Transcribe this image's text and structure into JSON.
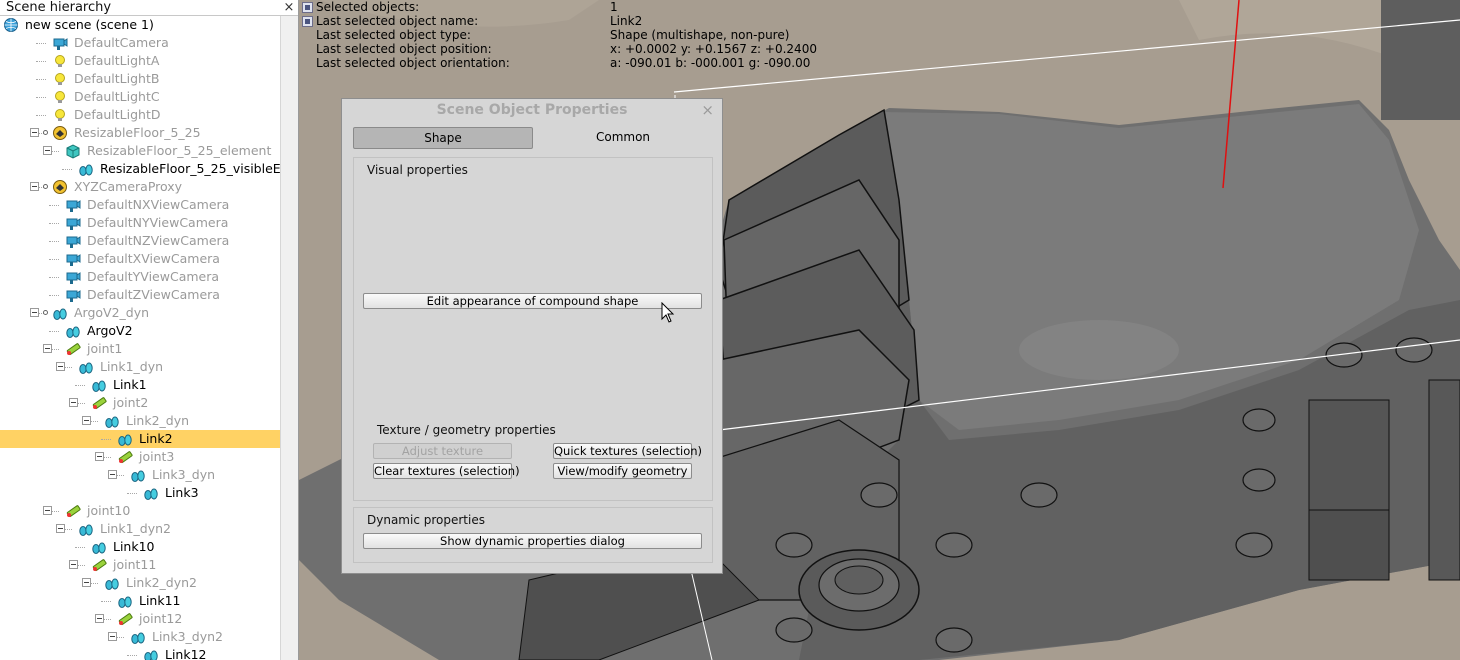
{
  "hierarchy": {
    "title": "Scene hierarchy",
    "close": "×",
    "items": [
      {
        "label": "new scene (scene 1)",
        "icon": "globe-icon",
        "depth": 0,
        "dim": false,
        "selected": false
      },
      {
        "label": "DefaultCamera",
        "icon": "camera-icon",
        "depth": 3,
        "dim": true,
        "selected": false
      },
      {
        "label": "DefaultLightA",
        "icon": "light-bulb-icon",
        "depth": 3,
        "dim": true,
        "selected": false
      },
      {
        "label": "DefaultLightB",
        "icon": "light-bulb-icon",
        "depth": 3,
        "dim": true,
        "selected": false
      },
      {
        "label": "DefaultLightC",
        "icon": "light-bulb-icon",
        "depth": 3,
        "dim": true,
        "selected": false
      },
      {
        "label": "DefaultLightD",
        "icon": "light-bulb-icon",
        "depth": 3,
        "dim": true,
        "selected": false
      },
      {
        "label": "ResizableFloor_5_25",
        "icon": "model-icon",
        "depth": 3,
        "dim": true,
        "selected": false
      },
      {
        "label": "ResizableFloor_5_25_element",
        "icon": "cube-icon",
        "depth": 4,
        "dim": true,
        "selected": false
      },
      {
        "label": "ResizableFloor_5_25_visibleElement",
        "icon": "shape-icon",
        "depth": 5,
        "dim": false,
        "selected": false
      },
      {
        "label": "XYZCameraProxy",
        "icon": "model-icon",
        "depth": 3,
        "dim": true,
        "selected": false
      },
      {
        "label": "DefaultNXViewCamera",
        "icon": "camera-icon",
        "depth": 4,
        "dim": true,
        "selected": false
      },
      {
        "label": "DefaultNYViewCamera",
        "icon": "camera-icon",
        "depth": 4,
        "dim": true,
        "selected": false
      },
      {
        "label": "DefaultNZViewCamera",
        "icon": "camera-icon",
        "depth": 4,
        "dim": true,
        "selected": false
      },
      {
        "label": "DefaultXViewCamera",
        "icon": "camera-icon",
        "depth": 4,
        "dim": true,
        "selected": false
      },
      {
        "label": "DefaultYViewCamera",
        "icon": "camera-icon",
        "depth": 4,
        "dim": true,
        "selected": false
      },
      {
        "label": "DefaultZViewCamera",
        "icon": "camera-icon",
        "depth": 4,
        "dim": true,
        "selected": false
      },
      {
        "label": "ArgoV2_dyn",
        "icon": "shape-icon",
        "depth": 3,
        "dim": true,
        "selected": false
      },
      {
        "label": "ArgoV2",
        "icon": "shape-icon",
        "depth": 4,
        "dim": false,
        "selected": false
      },
      {
        "label": "joint1",
        "icon": "joint-icon",
        "depth": 4,
        "dim": true,
        "selected": false
      },
      {
        "label": "Link1_dyn",
        "icon": "shape-icon",
        "depth": 5,
        "dim": true,
        "selected": false
      },
      {
        "label": "Link1",
        "icon": "shape-icon",
        "depth": 6,
        "dim": false,
        "selected": false
      },
      {
        "label": "joint2",
        "icon": "joint-icon",
        "depth": 6,
        "dim": true,
        "selected": false
      },
      {
        "label": "Link2_dyn",
        "icon": "shape-icon",
        "depth": 7,
        "dim": true,
        "selected": false
      },
      {
        "label": "Link2",
        "icon": "shape-icon",
        "depth": 8,
        "dim": false,
        "selected": true
      },
      {
        "label": "joint3",
        "icon": "joint-icon",
        "depth": 8,
        "dim": true,
        "selected": false
      },
      {
        "label": "Link3_dyn",
        "icon": "shape-icon",
        "depth": 9,
        "dim": true,
        "selected": false
      },
      {
        "label": "Link3",
        "icon": "shape-icon",
        "depth": 10,
        "dim": false,
        "selected": false
      },
      {
        "label": "joint10",
        "icon": "joint-icon",
        "depth": 4,
        "dim": true,
        "selected": false
      },
      {
        "label": "Link1_dyn2",
        "icon": "shape-icon",
        "depth": 5,
        "dim": true,
        "selected": false
      },
      {
        "label": "Link10",
        "icon": "shape-icon",
        "depth": 6,
        "dim": false,
        "selected": false
      },
      {
        "label": "joint11",
        "icon": "joint-icon",
        "depth": 6,
        "dim": true,
        "selected": false
      },
      {
        "label": "Link2_dyn2",
        "icon": "shape-icon",
        "depth": 7,
        "dim": true,
        "selected": false
      },
      {
        "label": "Link11",
        "icon": "shape-icon",
        "depth": 8,
        "dim": false,
        "selected": false
      },
      {
        "label": "joint12",
        "icon": "joint-icon",
        "depth": 8,
        "dim": true,
        "selected": false
      },
      {
        "label": "Link3_dyn2",
        "icon": "shape-icon",
        "depth": 9,
        "dim": true,
        "selected": false
      },
      {
        "label": "Link12",
        "icon": "shape-icon",
        "depth": 10,
        "dim": false,
        "selected": false
      }
    ]
  },
  "info": {
    "rows": [
      {
        "key": "Selected objects:",
        "value": "1"
      },
      {
        "key": "Last selected object name:",
        "value": "Link2"
      },
      {
        "key": "Last selected object type:",
        "value": "Shape (multishape, non-pure)"
      },
      {
        "key": "Last selected object position:",
        "value": "x: +0.0002   y: +0.1567   z: +0.2400"
      },
      {
        "key": "Last selected object orientation:",
        "value": "a: -090.01   b: -000.001   g: -090.00"
      }
    ]
  },
  "dialog": {
    "title": "Scene Object Properties",
    "close": "×",
    "tabs": {
      "shape": "Shape",
      "common": "Common"
    },
    "visual_title": "Visual properties",
    "edit_appearance": "Edit appearance of compound shape",
    "texture_title": "Texture / geometry properties",
    "adjust_texture": "Adjust texture",
    "quick_textures": "Quick textures (selection)",
    "clear_textures": "Clear textures (selection)",
    "view_geometry": "View/modify geometry",
    "dynamic_title": "Dynamic properties",
    "show_dynamic": "Show dynamic properties dialog"
  },
  "colors": {
    "selection": "#ffd264",
    "dialog_bg": "#d6d6d6",
    "model_gray": "#707070",
    "floor": "#a59b8e"
  }
}
